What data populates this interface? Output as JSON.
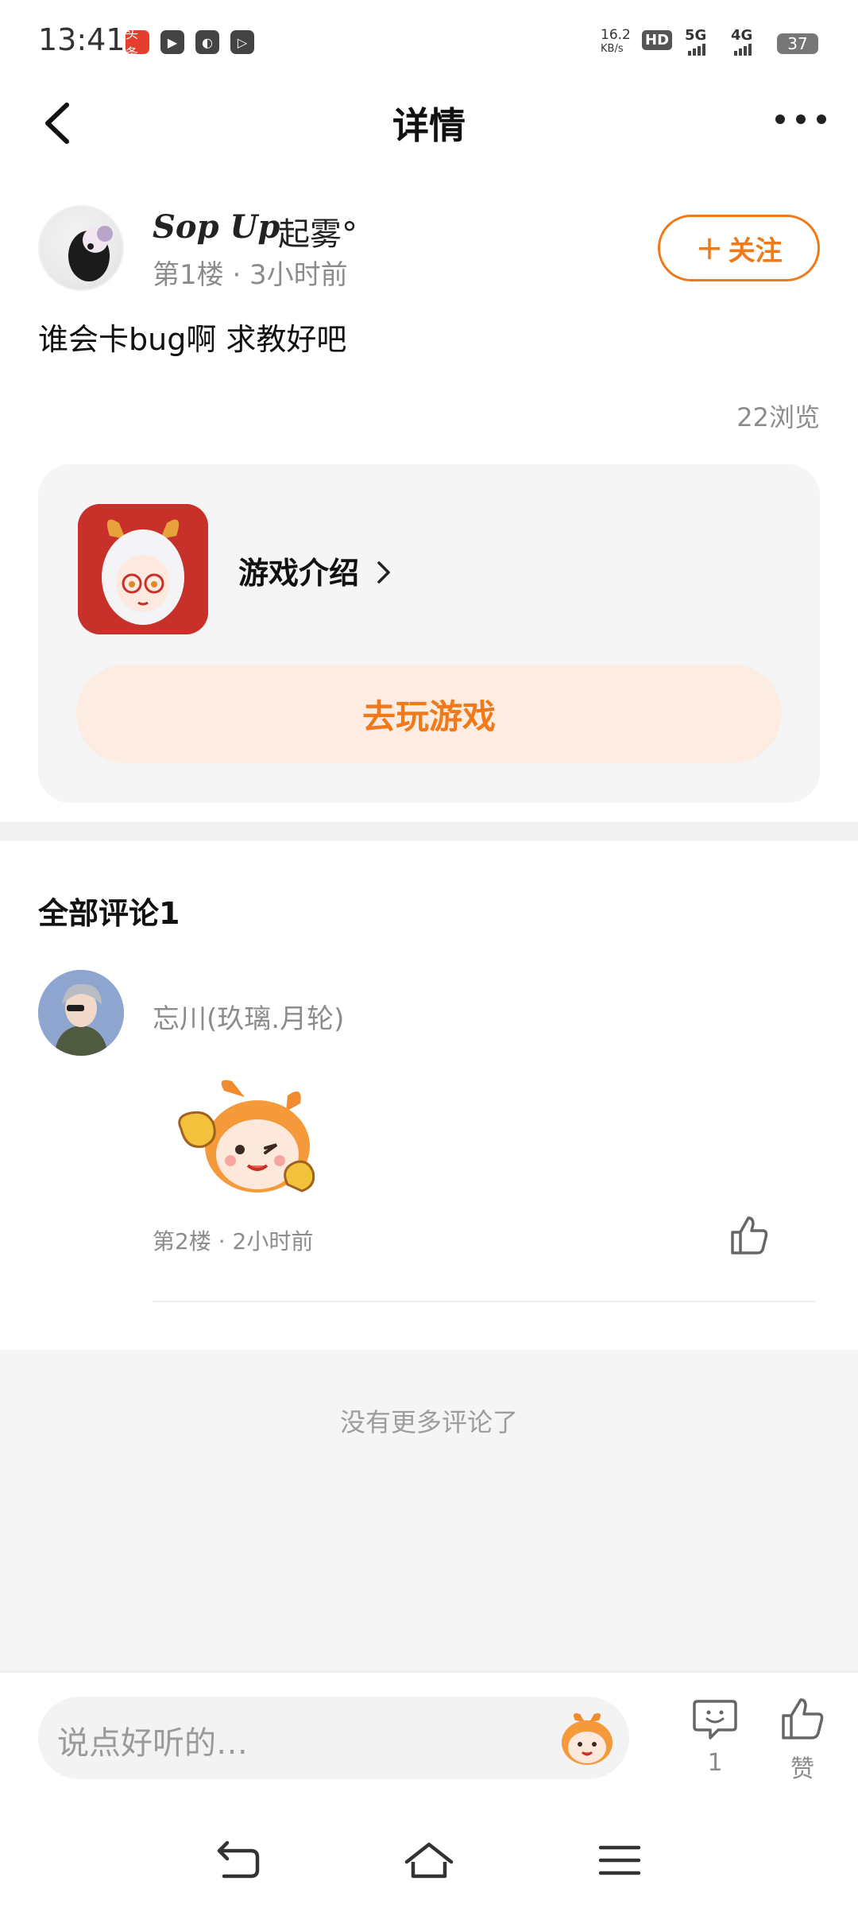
{
  "status_bar": {
    "time": "13:41",
    "app_badges": [
      "头条",
      "▶",
      "◐",
      "▷"
    ],
    "net_speed": "16.2",
    "net_speed_unit": "KB/s",
    "hd": "HD",
    "net1": "5G",
    "net2": "4G",
    "battery": "37"
  },
  "header": {
    "title": "详情",
    "back_icon": "chevron-left-icon",
    "more_icon": "more-dots-icon"
  },
  "post": {
    "author_script": "Sop Up",
    "author_name": "起雾°",
    "meta": "第1楼 · 3小时前",
    "follow_label": "关注",
    "follow_prefix": "+",
    "text": "谁会卡bug啊 求教好吧",
    "views": "22浏览"
  },
  "game_card": {
    "intro_label": "游戏介绍",
    "play_label": "去玩游戏"
  },
  "comments": {
    "title": "全部评论1",
    "items": [
      {
        "author": "忘川(玖璃.月轮)",
        "meta": "第2楼 · 2小时前"
      }
    ],
    "no_more": "没有更多评论了"
  },
  "bottom_bar": {
    "input_placeholder": "说点好听的…",
    "comment_count": "1",
    "like_label": "赞"
  },
  "colors": {
    "accent": "#f07a1a",
    "accent_bg": "#fdece2",
    "muted": "#8c8c8c"
  }
}
